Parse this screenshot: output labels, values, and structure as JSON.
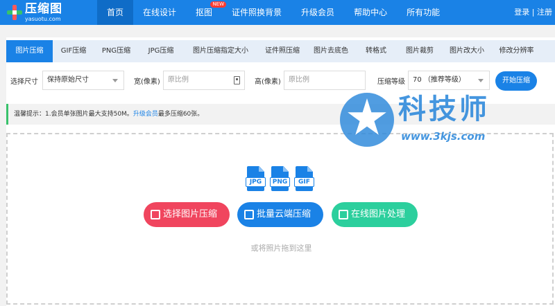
{
  "brand": {
    "title": "压缩图",
    "subtitle": "yasuotu.com"
  },
  "nav": {
    "items": [
      {
        "label": "首页"
      },
      {
        "label": "在线设计"
      },
      {
        "label": "抠图",
        "badge": "NEW"
      },
      {
        "label": "证件照换背景"
      },
      {
        "label": "升级会员"
      },
      {
        "label": "帮助中心"
      },
      {
        "label": "所有功能"
      }
    ],
    "auth": "登录 | 注册"
  },
  "tabs": [
    "图片压缩",
    "GIF压缩",
    "PNG压缩",
    "JPG压缩",
    "图片压缩指定大小",
    "证件照压缩",
    "图片去底色",
    "转格式",
    "图片裁剪",
    "图片改大小",
    "修改分辨率"
  ],
  "options": {
    "size_label": "选择尺寸",
    "size_value": "保持原始尺寸",
    "width_label": "宽(像素)",
    "width_placeholder": "原比例",
    "height_label": "高(像素)",
    "height_placeholder": "原比例",
    "level_label": "压缩等级",
    "level_value": "70 （推荐等级）",
    "start_label": "开始压缩"
  },
  "tip": {
    "text": "温馨提示：1.会员单张图片最大支持50M。",
    "link": "升级会员",
    "suffix": "最多压缩60张。"
  },
  "upload": {
    "filetypes": [
      "JPG",
      "PNG",
      "GIF"
    ],
    "buttons": [
      {
        "label": "选择图片压缩",
        "icon": "image-icon",
        "color": "#f0455e"
      },
      {
        "label": "批量云端压缩",
        "icon": "zip-icon",
        "color": "#1a82e6"
      },
      {
        "label": "在线图片处理",
        "icon": "edit-image-icon",
        "color": "#2ccf9d"
      }
    ],
    "hint": "或将照片拖到这里"
  },
  "watermark": {
    "text": "科技师",
    "url": "www.3kjs.com"
  },
  "colors": {
    "primary": "#1a82e6",
    "nav_active": "#0f6cc7",
    "tip_border": "#38c26b"
  }
}
